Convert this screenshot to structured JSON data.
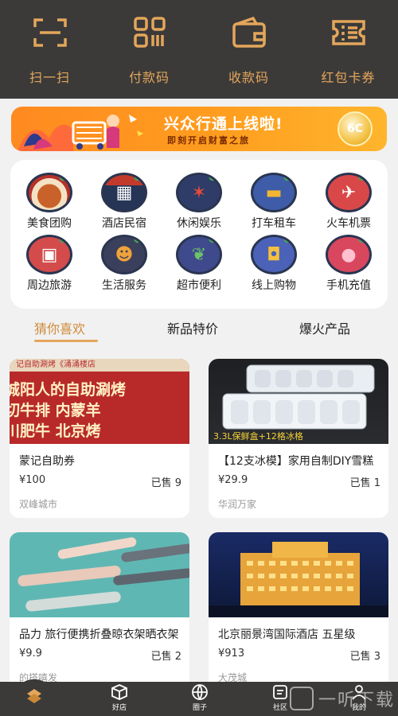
{
  "topbar": {
    "tools": [
      {
        "label": "扫一扫",
        "icon": "scan-icon"
      },
      {
        "label": "付款码",
        "icon": "qr-code-icon"
      },
      {
        "label": "收款码",
        "icon": "wallet-icon"
      },
      {
        "label": "红包卡券",
        "icon": "coupon-icon"
      }
    ],
    "accent": "#e4a65b",
    "background": "#3b3a39"
  },
  "banner": {
    "headline": "兴众行通上线啦!",
    "subline": "即刻开启财富之旅",
    "badge": "6C"
  },
  "categories": [
    {
      "label": "美食团购",
      "icon": "food-icon"
    },
    {
      "label": "酒店民宿",
      "icon": "hotel-icon"
    },
    {
      "label": "休闲娱乐",
      "icon": "leisure-icon"
    },
    {
      "label": "打车租车",
      "icon": "taxi-icon"
    },
    {
      "label": "火车机票",
      "icon": "plane-icon"
    },
    {
      "label": "周边旅游",
      "icon": "luggage-icon"
    },
    {
      "label": "生活服务",
      "icon": "service-icon"
    },
    {
      "label": "超市便利",
      "icon": "grocery-icon"
    },
    {
      "label": "线上购物",
      "icon": "shopping-bag-icon"
    },
    {
      "label": "手机充值",
      "icon": "piggy-bank-icon"
    }
  ],
  "tabs": [
    {
      "label": "猜你喜欢",
      "active": true
    },
    {
      "label": "新品特价",
      "active": false
    },
    {
      "label": "爆火产品",
      "active": false
    }
  ],
  "products": [
    {
      "title": "蒙记自助券",
      "price": "¥100",
      "sold": "已售 9",
      "shop": "双峰城市",
      "image_text": [
        "记自助涮烤《涌涌楼店",
        "城阳人的自助涮烤",
        "切牛排 内蒙羊",
        "川肥牛 北京烤"
      ]
    },
    {
      "title": "【12支冰模】家用自制DIY雪糕",
      "price": "¥29.9",
      "sold": "已售 1",
      "shop": "华润万家",
      "image_text": [
        "3.3L保鲜盒+12格冰格"
      ]
    },
    {
      "title": "品力 旅行便携折叠晾衣架晒衣架",
      "price": "¥9.9",
      "sold": "已售 2",
      "shop": "的搭嘻发",
      "image_text": []
    },
    {
      "title": "北京丽景湾国际酒店 五星级",
      "price": "¥913",
      "sold": "已售 3",
      "shop": "大茂城",
      "image_text": []
    }
  ],
  "navbar": {
    "items": [
      {
        "label": "好店",
        "icon": "box-icon"
      },
      {
        "label": "圈子",
        "icon": "globe-icon"
      },
      {
        "label": "社区",
        "icon": "community-icon"
      },
      {
        "label": "我的",
        "icon": "user-icon"
      }
    ]
  },
  "watermark": {
    "text": "一听下载"
  }
}
